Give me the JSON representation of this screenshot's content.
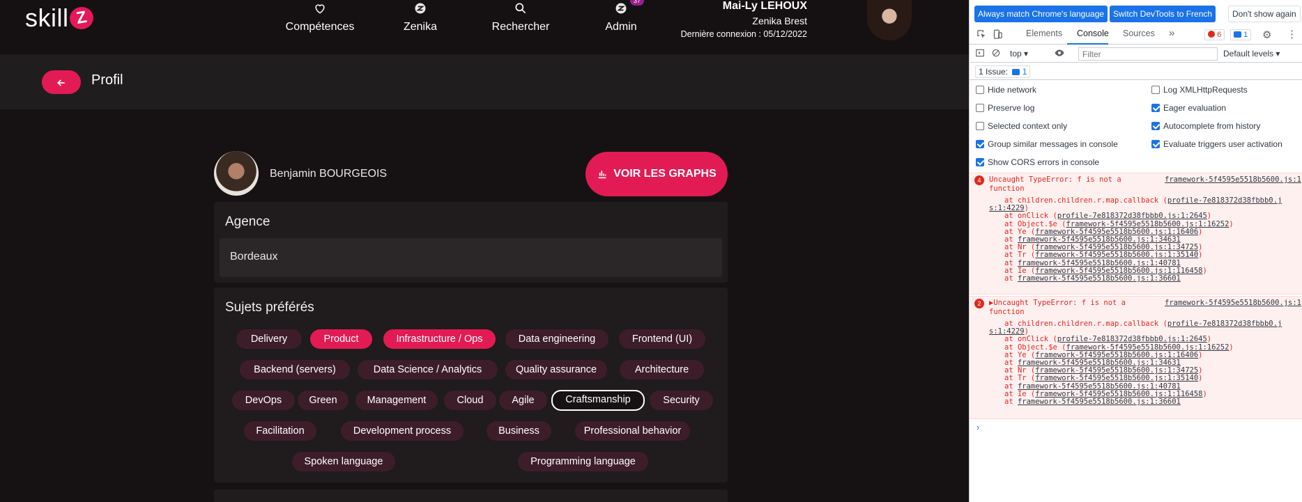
{
  "app": {
    "logo_text": "skill",
    "logo_mark": "Z",
    "nav": [
      {
        "label": "Compétences",
        "icon": "heart-icon"
      },
      {
        "label": "Zenika",
        "icon": "zenika-icon"
      },
      {
        "label": "Rechercher",
        "icon": "search-icon"
      },
      {
        "label": "Admin",
        "icon": "zenika-icon",
        "badge": "37"
      }
    ],
    "user": {
      "name": "Mai-Ly LEHOUX",
      "org": "Zenika Brest",
      "last_login": "Dernière connexion : 05/12/2022"
    }
  },
  "page": {
    "title": "Profil",
    "back_icon": "arrow-left-icon"
  },
  "profile": {
    "name": "Benjamin BOURGEOIS",
    "graphs_button": "VOIR LES GRAPHS",
    "graphs_icon": "bar-chart-icon"
  },
  "agency": {
    "title": "Agence",
    "value": "Bordeaux"
  },
  "topics": {
    "title": "Sujets préférés",
    "items": [
      {
        "label": "Delivery",
        "state": "default"
      },
      {
        "label": "Product",
        "state": "selected"
      },
      {
        "label": "Infrastructure / Ops",
        "state": "selected"
      },
      {
        "label": "Data engineering",
        "state": "default"
      },
      {
        "label": "Frontend (UI)",
        "state": "default"
      },
      {
        "label": "Backend (servers)",
        "state": "default"
      },
      {
        "label": "Data Science / Analytics",
        "state": "default"
      },
      {
        "label": "Quality assurance",
        "state": "default"
      },
      {
        "label": "Architecture",
        "state": "default"
      },
      {
        "label": "DevOps",
        "state": "default"
      },
      {
        "label": "Green",
        "state": "default"
      },
      {
        "label": "Management",
        "state": "default"
      },
      {
        "label": "Cloud",
        "state": "default"
      },
      {
        "label": "Agile",
        "state": "default"
      },
      {
        "label": "Craftsmanship",
        "state": "focused"
      },
      {
        "label": "Security",
        "state": "default"
      },
      {
        "label": "Facilitation",
        "state": "default"
      },
      {
        "label": "Development process",
        "state": "default"
      },
      {
        "label": "Business",
        "state": "default"
      },
      {
        "label": "Professional behavior",
        "state": "default"
      },
      {
        "label": "Spoken language",
        "state": "default"
      },
      {
        "label": "Programming language",
        "state": "default"
      }
    ],
    "colors": {
      "default": "#3e1d2b",
      "selected": "#e31b55",
      "accent": "#e31b55"
    }
  },
  "devtools": {
    "banner": {
      "match_language": "Always match Chrome's language",
      "switch_french": "Switch DevTools to French",
      "dont_show": "Don't show again"
    },
    "tabs": [
      "Elements",
      "Console",
      "Sources"
    ],
    "active_tab": "Console",
    "more_tabs": "»",
    "error_count": "6",
    "message_count": "1",
    "toolbar": {
      "context": "top",
      "filter_placeholder": "Filter",
      "levels": "Default levels"
    },
    "issues": {
      "label": "1 Issue:",
      "count": "1"
    },
    "settings_left": [
      {
        "label": "Hide network",
        "checked": false
      },
      {
        "label": "Preserve log",
        "checked": false
      },
      {
        "label": "Selected context only",
        "checked": false
      },
      {
        "label": "Group similar messages in console",
        "checked": true
      },
      {
        "label": "Show CORS errors in console",
        "checked": true
      }
    ],
    "settings_right": [
      {
        "label": "Log XMLHttpRequests",
        "checked": false
      },
      {
        "label": "Eager evaluation",
        "checked": true
      },
      {
        "label": "Autocomplete from history",
        "checked": true
      },
      {
        "label": "Evaluate triggers user activation",
        "checked": true
      }
    ],
    "errors": [
      {
        "count": "4",
        "expander": "",
        "message": "Uncaught TypeError: f is not a function",
        "source": "framework-5f4595e5518b5600.js:1",
        "stack": [
          [
            "at children.children.r.map.callback (",
            "profile-7e818372d38fbbb0.j",
            ""
          ],
          [
            "",
            "s:1:4229",
            ")"
          ],
          [
            "at onClick (",
            "profile-7e818372d38fbbb0.js:1:2645",
            ")"
          ],
          [
            "at Object.$e (",
            "framework-5f4595e5518b5600.js:1:16252",
            ")"
          ],
          [
            "at Ye (",
            "framework-5f4595e5518b5600.js:1:16406",
            ")"
          ],
          [
            "at ",
            "framework-5f4595e5518b5600.js:1:34631",
            ""
          ],
          [
            "at Nr (",
            "framework-5f4595e5518b5600.js:1:34725",
            ")"
          ],
          [
            "at Tr (",
            "framework-5f4595e5518b5600.js:1:35140",
            ")"
          ],
          [
            "at ",
            "framework-5f4595e5518b5600.js:1:40781",
            ""
          ],
          [
            "at Ie (",
            "framework-5f4595e5518b5600.js:1:116458",
            ")"
          ],
          [
            "at ",
            "framework-5f4595e5518b5600.js:1:36601",
            ""
          ]
        ]
      },
      {
        "count": "2",
        "expander": "▶",
        "message": "Uncaught TypeError: f is not a function",
        "source": "framework-5f4595e5518b5600.js:1",
        "stack": [
          [
            "at children.children.r.map.callback (",
            "profile-7e818372d38fbbb0.j",
            ""
          ],
          [
            "",
            "s:1:4229",
            ")"
          ],
          [
            "at onClick (",
            "profile-7e818372d38fbbb0.js:1:2645",
            ")"
          ],
          [
            "at Object.$e (",
            "framework-5f4595e5518b5600.js:1:16252",
            ")"
          ],
          [
            "at Ye (",
            "framework-5f4595e5518b5600.js:1:16406",
            ")"
          ],
          [
            "at ",
            "framework-5f4595e5518b5600.js:1:34631",
            ""
          ],
          [
            "at Nr (",
            "framework-5f4595e5518b5600.js:1:34725",
            ")"
          ],
          [
            "at Tr (",
            "framework-5f4595e5518b5600.js:1:35140",
            ")"
          ],
          [
            "at ",
            "framework-5f4595e5518b5600.js:1:40781",
            ""
          ],
          [
            "at Ie (",
            "framework-5f4595e5518b5600.js:1:116458",
            ")"
          ],
          [
            "at ",
            "framework-5f4595e5518b5600.js:1:36601",
            ""
          ]
        ]
      }
    ],
    "prompt": "›"
  }
}
